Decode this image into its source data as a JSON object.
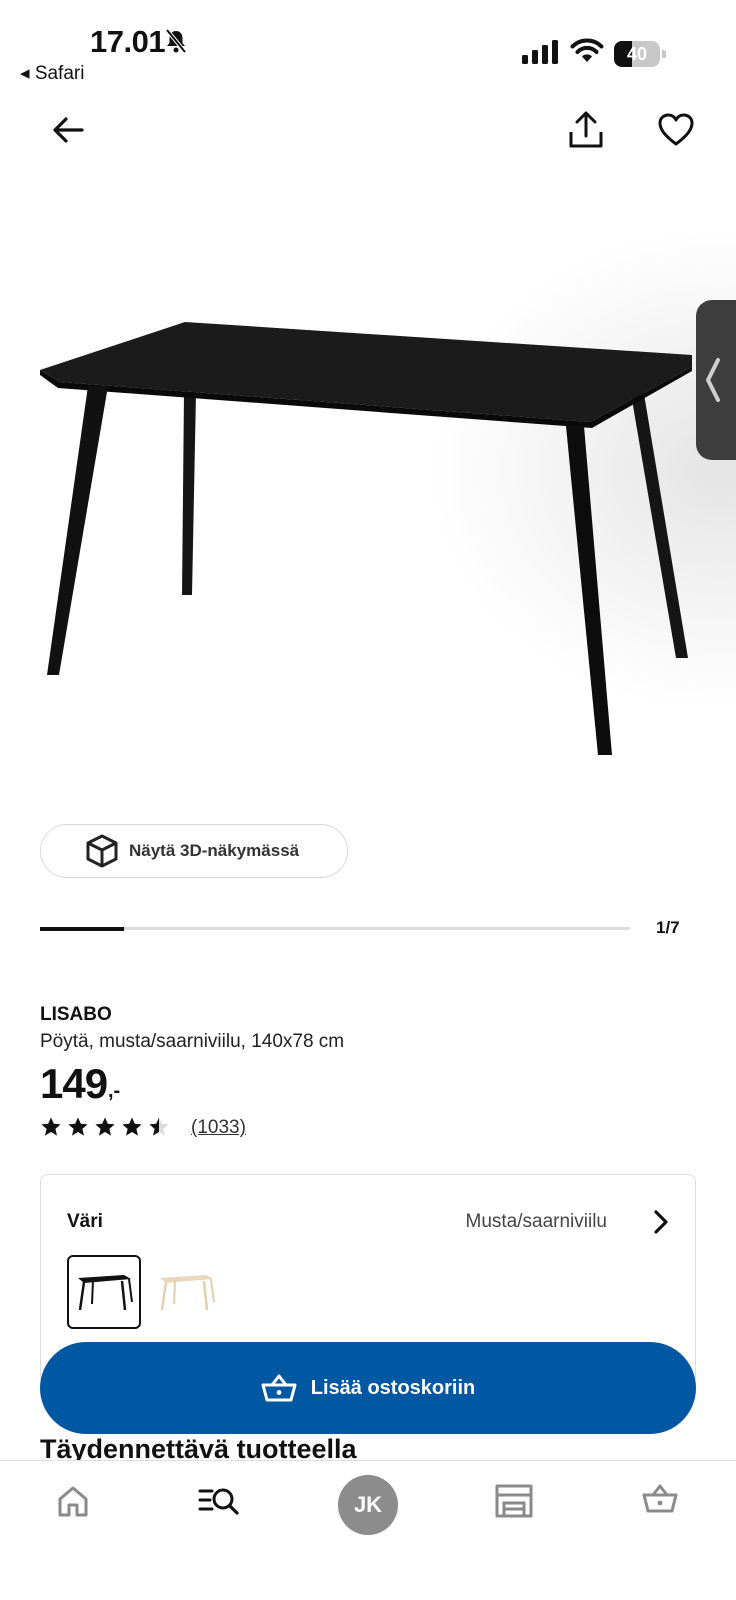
{
  "status_bar": {
    "time": "17.01",
    "back_app": "◂ Safari",
    "battery": "40",
    "battery_level": 0.4
  },
  "nav": {
    "back_icon": "arrow-left-icon",
    "share_icon": "share-icon",
    "favorite_icon": "heart-icon"
  },
  "gallery": {
    "view_3d_label": "Näytä 3D-näkymässä",
    "counter": "1/7",
    "current_index": 1,
    "total_images": 7
  },
  "product": {
    "name": "LISABO",
    "description": "Pöytä, musta/saarniviilu, 140x78 cm",
    "price": "149",
    "price_suffix": ",-",
    "rating": 4.5,
    "reviews": "(1033)"
  },
  "color_selector": {
    "label": "Väri",
    "selected_value": "Musta/saarniviilu",
    "swatches": [
      "black",
      "ash"
    ]
  },
  "cart": {
    "add_label": "Lisää ostoskoriin"
  },
  "section": {
    "title": "Täydennettävä tuotteella"
  },
  "tabbar": {
    "avatar_initials": "JK"
  },
  "colors": {
    "brand_blue": "#0058a3",
    "avatar_grey": "#8c8c8c"
  }
}
